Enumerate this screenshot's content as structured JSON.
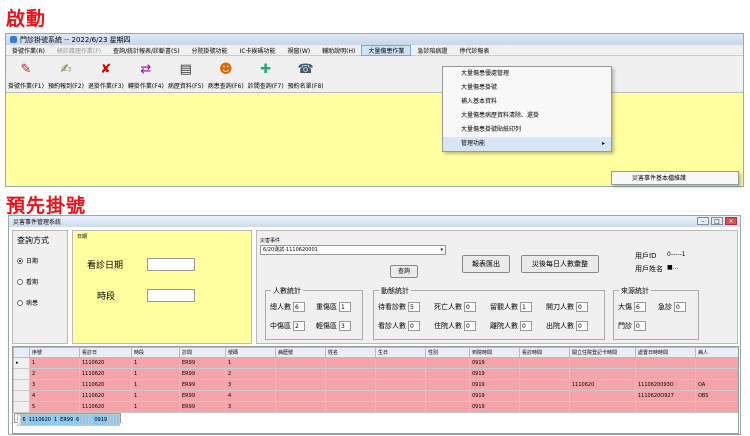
{
  "headings": {
    "first": "啟動",
    "second": "預先掛號"
  },
  "win1": {
    "title": "門診掛號系統 -- 2022/6/23 星期四",
    "menu": [
      "掛號作業(R)",
      "候診護理作業(F)",
      "查詢/統計報表/診斷書(S)",
      "分院掛號功能",
      "IC卡挨碼功能",
      "視窗(W)",
      "輔助說明(H)",
      "大量傷患作業",
      "急診陪病證",
      "停代診報表"
    ],
    "toolbar": [
      "掛號作業(F1)",
      "預約報到(F2)",
      "退掛作業(F3)",
      "轉掛作業(F4)",
      "病歷資料(F5)",
      "病患查詢(F6)",
      "診間查詢(F7)",
      "預約名單(F8)"
    ],
    "dropdown": [
      "大量傷患優處管理",
      "大量傷患掛號",
      "補入基本資料",
      "大量傷患病歷資料清除、還掛",
      "大量傷患掛號貼紙印列",
      "管理功能"
    ],
    "submenu": "災害事件基本檔維護"
  },
  "win2": {
    "title": "災害事件管理系統",
    "query_title": "查詢方式",
    "radios": [
      "日期",
      "看期",
      "病患"
    ],
    "date_small": "日期",
    "date_label": "看診日期",
    "time_label": "時段",
    "event_label": "災害事件",
    "event_value": "6/20測試-1110620001",
    "query_btn": "查詢",
    "export_btn": "報表匯出",
    "daily_btn": "災後每日人數彙整",
    "user_id_label": "用戶ID",
    "user_id_value": "0-----1",
    "user_name_label": "用戶姓名",
    "user_name_value": "■...",
    "group1": {
      "title": "人數統計",
      "items": [
        {
          "label": "總人數",
          "value": "6"
        },
        {
          "label": "重傷區",
          "value": "1"
        },
        {
          "label": "中傷區",
          "value": "2"
        },
        {
          "label": "輕傷區",
          "value": "3"
        }
      ]
    },
    "group2": {
      "title": "動態統計",
      "items": [
        {
          "label": "待看診數",
          "value": "5"
        },
        {
          "label": "死亡人數",
          "value": "0"
        },
        {
          "label": "留觀人數",
          "value": "1"
        },
        {
          "label": "開刀人數",
          "value": "0"
        },
        {
          "label": "看診人數",
          "value": "0"
        },
        {
          "label": "住院人數",
          "value": "0"
        },
        {
          "label": "離院人數",
          "value": "0"
        },
        {
          "label": "出院人數",
          "value": "0"
        }
      ]
    },
    "group3": {
      "title": "來源統計",
      "items": [
        {
          "label": "大傷",
          "value": "6"
        },
        {
          "label": "急診",
          "value": "0"
        },
        {
          "label": "門診",
          "value": "0"
        }
      ]
    },
    "columns": [
      "",
      "序號",
      "看診日",
      "時段",
      "診間",
      "號碼",
      "病歷號",
      "姓名",
      "生日",
      "性別",
      "到院時間",
      "看診時間",
      "開立住院登記卡時間",
      "處置日時時間",
      "病人"
    ],
    "rows": [
      [
        "▸",
        "1",
        "1110620",
        "1",
        "ER99",
        "1",
        "",
        "",
        "",
        "",
        "0919",
        "",
        "",
        "",
        ""
      ],
      [
        "",
        "2",
        "1110620",
        "1",
        "ER99",
        "2",
        "",
        "",
        "",
        "",
        "0919",
        "",
        "",
        "",
        ""
      ],
      [
        "",
        "3",
        "1110620",
        "1",
        "ER99",
        "3",
        "",
        "",
        "",
        "",
        "0919",
        "",
        "1110620",
        "1110620093O",
        "OA"
      ],
      [
        "",
        "4",
        "1110620",
        "1",
        "ER99",
        "4",
        "",
        "",
        "",
        "",
        "0919",
        "",
        "",
        "1110620O927",
        "OBS"
      ],
      [
        "",
        "5",
        "1110620",
        "1",
        "ER99",
        "3",
        "",
        "",
        "",
        "",
        "0919",
        "",
        "",
        "",
        ""
      ],
      [
        "",
        "6",
        "1110620",
        "1",
        "ER99",
        "6",
        "",
        "",
        "",
        "",
        "0919",
        "",
        "",
        "",
        ""
      ]
    ]
  }
}
